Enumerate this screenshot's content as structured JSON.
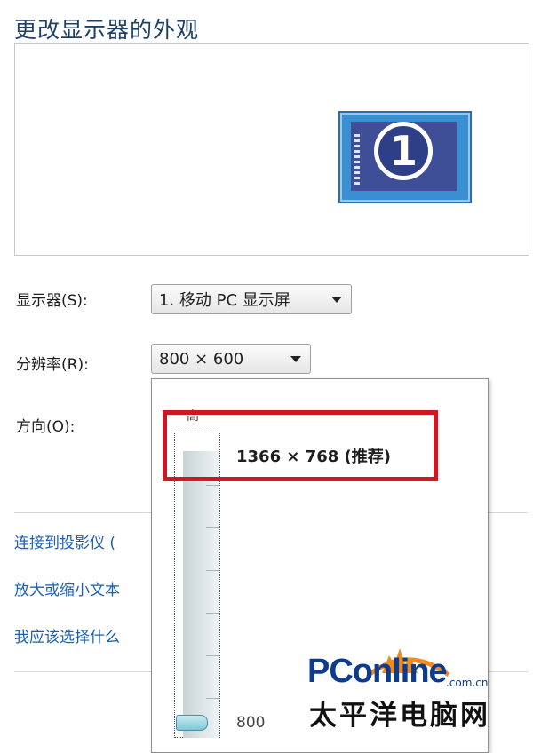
{
  "window": {
    "title": "更改显示器的外观"
  },
  "preview": {
    "monitor_number": "1"
  },
  "display": {
    "label": "显示器(S):",
    "value": "1. 移动 PC 显示屏"
  },
  "resolution": {
    "label": "分辨率(R):",
    "value": "800 × 600",
    "popup": {
      "top_label": "高",
      "selected_option": "1366 × 768 (推荐)",
      "bottom_label": "800"
    }
  },
  "orientation": {
    "label": "方向(O):"
  },
  "links": [
    {
      "label": "连接到投影仪 ("
    },
    {
      "label": "放大或缩小文本"
    },
    {
      "label": "我应该选择什么"
    }
  ],
  "watermark": {
    "brand": "PConline",
    "domain": ".com.cn",
    "cn_name": "太平洋电脑网"
  },
  "colors": {
    "highlight": "#d0161e",
    "link": "#1a5fb4",
    "title": "#1e3f66",
    "brand": "#0d3c8c"
  },
  "icons": [
    "monitor-preview-icon",
    "dropdown-arrow-icon",
    "slider-thumb-icon",
    "pconline-logo"
  ]
}
